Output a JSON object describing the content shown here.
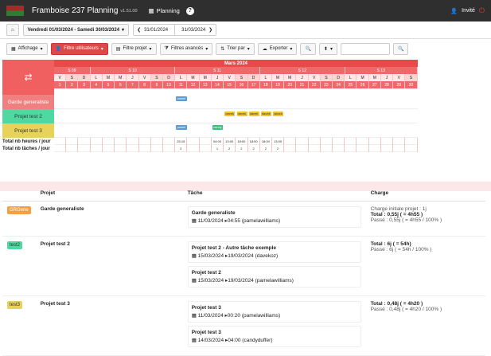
{
  "nav": {
    "title": "Framboise 237 Planning",
    "version": "v1.51.00",
    "planning": "Planning",
    "help": "?",
    "user": "Invité"
  },
  "bar1": {
    "home": "⌂",
    "period": "Vendredi 01/03/2024 - Samedi 30/03/2024",
    "prev_date": "31/01/2024",
    "next_date": "31/03/2024"
  },
  "bar2": {
    "affichage": "Affichage",
    "filtre_users": "Filtre utilisateurs",
    "filtre_projet": "Filtre projet",
    "filtres_avances": "Filtres avancés",
    "trier": "Trier par",
    "exporter": "Exporter"
  },
  "grid": {
    "month": "Mars 2024",
    "swap": "⇄",
    "weeks": [
      {
        "label": "S 09",
        "n": 3
      },
      {
        "label": "S 10",
        "n": 7
      },
      {
        "label": "S 11",
        "n": 7
      },
      {
        "label": "S 12",
        "n": 7
      },
      {
        "label": "S 13",
        "n": 6
      }
    ],
    "days": [
      "V",
      "S",
      "D",
      "L",
      "M",
      "M",
      "J",
      "V",
      "S",
      "D",
      "L",
      "M",
      "M",
      "J",
      "V",
      "S",
      "D",
      "L",
      "M",
      "M",
      "J",
      "V",
      "S",
      "D",
      "L",
      "M",
      "M",
      "J",
      "V",
      "S"
    ],
    "dates": [
      "1",
      "2",
      "3",
      "4",
      "5",
      "6",
      "7",
      "8",
      "9",
      "10",
      "11",
      "12",
      "13",
      "14",
      "15",
      "16",
      "17",
      "18",
      "19",
      "20",
      "21",
      "22",
      "23",
      "24",
      "25",
      "26",
      "27",
      "28",
      "29",
      "30"
    ],
    "projects": [
      {
        "name": "Garde generaliste",
        "color": "#f08080"
      },
      {
        "name": "Projet test 2",
        "color": "#4dd9a0"
      },
      {
        "name": "Projet test 3",
        "color": "#e8d35a"
      }
    ],
    "total_hours_label": "Total nb heures / jour",
    "total_tasks_label": "Total nb tâches / jour",
    "hours": {
      "11": "25:15",
      "14": "04:00",
      "15": "13:00",
      "16": "18:00",
      "17": "18:00",
      "18": "18:00",
      "19": "13:00"
    },
    "tasks_count": {
      "11": "2",
      "14": "1",
      "15": "2",
      "16": "2",
      "17": "2",
      "18": "2",
      "19": "2"
    },
    "bars": [
      {
        "row": 0,
        "start": 11,
        "label": "pamel"
      },
      {
        "row": 1,
        "start": 15,
        "label": "davek"
      },
      {
        "row": 1,
        "start": 16,
        "label": "davek"
      },
      {
        "row": 1,
        "start": 17,
        "label": "davek"
      },
      {
        "row": 1,
        "start": 18,
        "label": "davek"
      },
      {
        "row": 1,
        "start": 19,
        "label": "davek"
      },
      {
        "row": 2,
        "start": 11,
        "label": "pamel"
      },
      {
        "row": 2,
        "start": 14,
        "label": "candy"
      }
    ]
  },
  "table": {
    "headers": {
      "projet": "Projet",
      "tache": "Tâche",
      "charge": "Charge"
    },
    "rows": [
      {
        "tag": "GRGene",
        "tag_color": "#f4a040",
        "project": "Garde generaliste",
        "tasks": [
          {
            "title": "Garde generaliste",
            "info": "▦ 11/03/2024 ▸04:55 (pamelawilliams)"
          }
        ],
        "charge": [
          "Charge initiale projet : 1j",
          "Total : 0,55j ( = 4h55 )",
          "Passé : 0,55j ( = 4h55 / 100% )"
        ]
      },
      {
        "tag": "test2",
        "tag_color": "#4dd9a0",
        "project": "Projet test 2",
        "tasks": [
          {
            "title": "Projet test 2 - Autre tâche exemple",
            "info": "▦ 15/03/2024 ▸19/03/2024 (davekoz)"
          },
          {
            "title": "Projet test 2",
            "info": "▦ 15/03/2024 ▸19/03/2024 (pamelawilliams)"
          }
        ],
        "charge": [
          "Total : 6j ( = 54h)",
          "Passé : 6j ( = 54h / 100% )"
        ]
      },
      {
        "tag": "test3",
        "tag_color": "#e8d35a",
        "project": "Projet test 3",
        "tasks": [
          {
            "title": "Projet test 3",
            "info": "▦ 11/03/2024 ▸00:20 (pamelawilliams)"
          },
          {
            "title": "Projet test 3",
            "info": "▦ 14/03/2024 ▸04:00 (candyduffer)"
          }
        ],
        "charge": [
          "Total : 0,48j ( = 4h20 )",
          "Passé : 0,48j ( = 4h20 / 100% )"
        ]
      }
    ]
  }
}
